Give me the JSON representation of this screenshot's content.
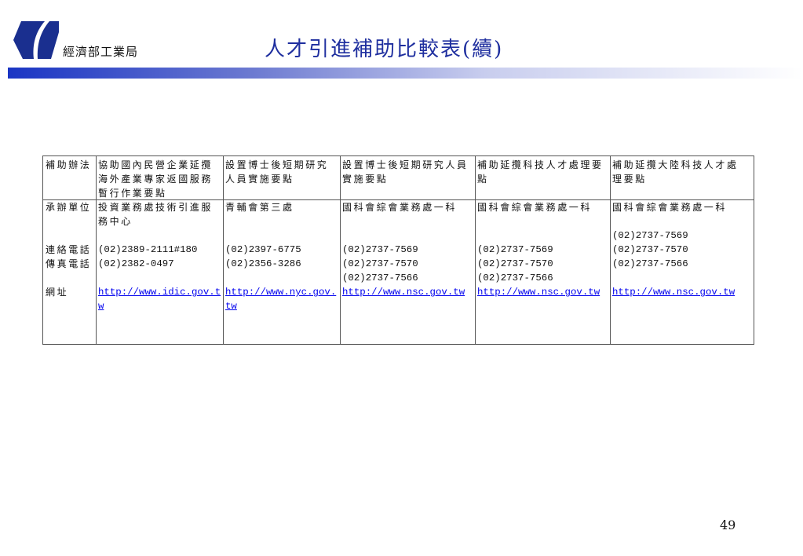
{
  "header": {
    "org": "經濟部工業局",
    "title": "人才引進補助比較表(續)"
  },
  "table": {
    "row_labels": {
      "program": "補助辦法",
      "unit": "承辦單位",
      "phone": "連絡電話",
      "fax": "傳真電話",
      "url": "網址"
    },
    "columns": [
      {
        "program": [
          "協助國內民營企業延攬",
          "海外產業專家返國服務",
          "暫行作業要點"
        ],
        "unit": [
          "投資業務處技術引進服",
          "務中心"
        ],
        "phone_lines": {
          "4": "(02)2389-2111#180",
          "5": "(02)2382-0497"
        },
        "url": "http://www.idic.gov.tw"
      },
      {
        "program": [
          "設置博士後短期研究",
          "人員實施要點"
        ],
        "unit": [
          "青輔會第三處"
        ],
        "phone_lines": {
          "4": "(02)2397-6775",
          "5": "(02)2356-3286"
        },
        "url": "http://www.nyc.gov.tw"
      },
      {
        "program": [
          "設置博士後短期研究人員",
          "實施要點"
        ],
        "unit": [
          "國科會綜會業務處一科"
        ],
        "phone_lines": {
          "4": "(02)2737-7569",
          "5": "(02)2737-7570",
          "6": "(02)2737-7566"
        },
        "url": "http://www.nsc.gov.tw"
      },
      {
        "program": [
          "補助延攬科技人才處理要",
          "點"
        ],
        "unit": [
          "國科會綜會業務處一科"
        ],
        "phone_lines": {
          "4": "(02)2737-7569",
          "5": "(02)2737-7570",
          "6": "(02)2737-7566"
        },
        "url": "http://www.nsc.gov.tw"
      },
      {
        "program": [
          "補助延攬大陸科技人才處",
          "理要點"
        ],
        "unit": [
          "國科會綜會業務處一科"
        ],
        "phone_lines": {
          "3": "(02)2737-7569",
          "4": "(02)2737-7570",
          "5": "(02)2737-7566"
        },
        "url": "http://www.nsc.gov.tw"
      }
    ]
  },
  "page_number": "49",
  "colors": {
    "title": "#1f2f9f",
    "logo": "#1a2f8f",
    "link": "#0000ee"
  }
}
